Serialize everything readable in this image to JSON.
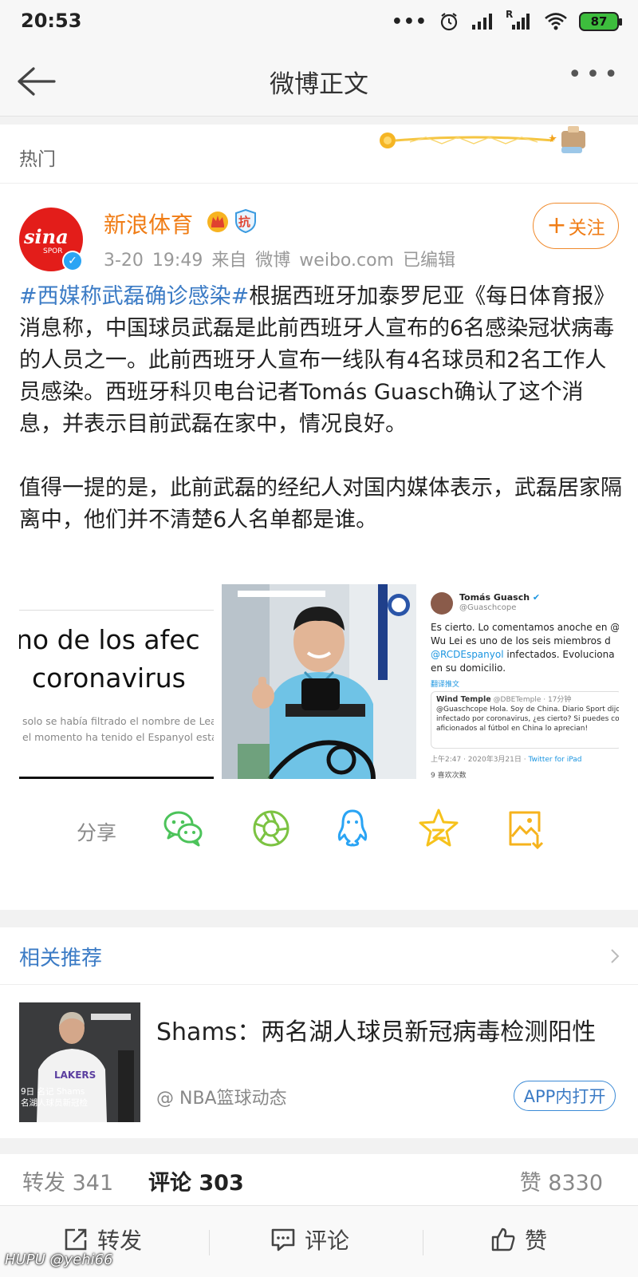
{
  "status_bar": {
    "time": "20:53",
    "battery": "87",
    "signal_label": "R"
  },
  "nav": {
    "title": "微博正文"
  },
  "hot": {
    "label": "热门"
  },
  "post": {
    "username": "新浪体育",
    "avatar_text": "sina",
    "avatar_sub": "SPOR",
    "badge_text": "抗",
    "meta": "3-20 19:49  来自 微博 weibo.com  已编辑",
    "follow_label": "关注",
    "topic": "#西媒称武磊确诊感染#",
    "paragraph1": "根据西班牙加泰罗尼亚《每日体育报》消息称，中国球员武磊是此前西班牙人宣布的6名感染冠状病毒的人员之一。此前西班牙人宣布一线队有4名球员和2名工作人员感染。西班牙科贝电台记者Tomás Guasch确认了这个消息，并表示目前武磊在家中，情况良好。",
    "paragraph2": "值得一提的是，此前武磊的经纪人对国内媒体表示，武磊居家隔离中，他们并不清楚6人名单都是谁。",
    "image1": {
      "line1": "no de los afec",
      "line2": "coronavirus",
      "small1": "solo se había filtrado el nombre de Lea",
      "small2": "el momento ha tenido el Espanyol estár"
    },
    "image3": {
      "name": "Tomás Guasch",
      "handle": "@Guaschcope",
      "l1": "Es cierto. Lo comentamos anoche en @",
      "l2": " Wu Lei es uno de los seis miembros d",
      "l3_handle": "@RCDEspanyol",
      "l3_rest": " infectados. Evoluciona",
      "l4": "en su domicilio.",
      "translate": "翻译推文",
      "q_name": "Wind Temple",
      "q_handle": "@DBETemple · 17分钟",
      "q1": "@Guaschcope Hola. Soy de China. Diario Sport dijo, ust",
      "q2": "infectado por coronavirus, ¿es cierto? Si puedes confirm",
      "q3": "aficionados al fútbol en China lo aprecian!",
      "time": "上午2:47 · 2020年3月21日 · ",
      "time_link": "Twitter for iPad",
      "likes": "9 喜欢次数"
    }
  },
  "share": {
    "label": "分享",
    "icons": [
      "wechat-icon",
      "moments-icon",
      "qq-icon",
      "qzone-icon",
      "save-image-icon"
    ]
  },
  "recommend": {
    "title": "相关推荐",
    "headline": "Shams：两名湖人球员新冠病毒检测阳性",
    "source": "@ NBA篮球动态",
    "open_label": "APP内打开",
    "img_cap1": "9日 名记 Shams",
    "img_cap2": "名湖人球员新冠检",
    "img_jersey": "LAKERS"
  },
  "stats": {
    "repost": "转发 341",
    "comment": "评论 303",
    "like": "赞 8330"
  },
  "actions": {
    "repost": "转发",
    "comment": "评论",
    "like": "赞"
  },
  "watermark": "HUPU @yehi66",
  "colors": {
    "accent_orange": "#f07d16",
    "link_blue": "#3b7bc5",
    "wechat_green": "#4cc35a",
    "qq_blue": "#2aa4f4",
    "qzone_yellow": "#f6c21c",
    "battery_green": "#3dbd3d"
  }
}
